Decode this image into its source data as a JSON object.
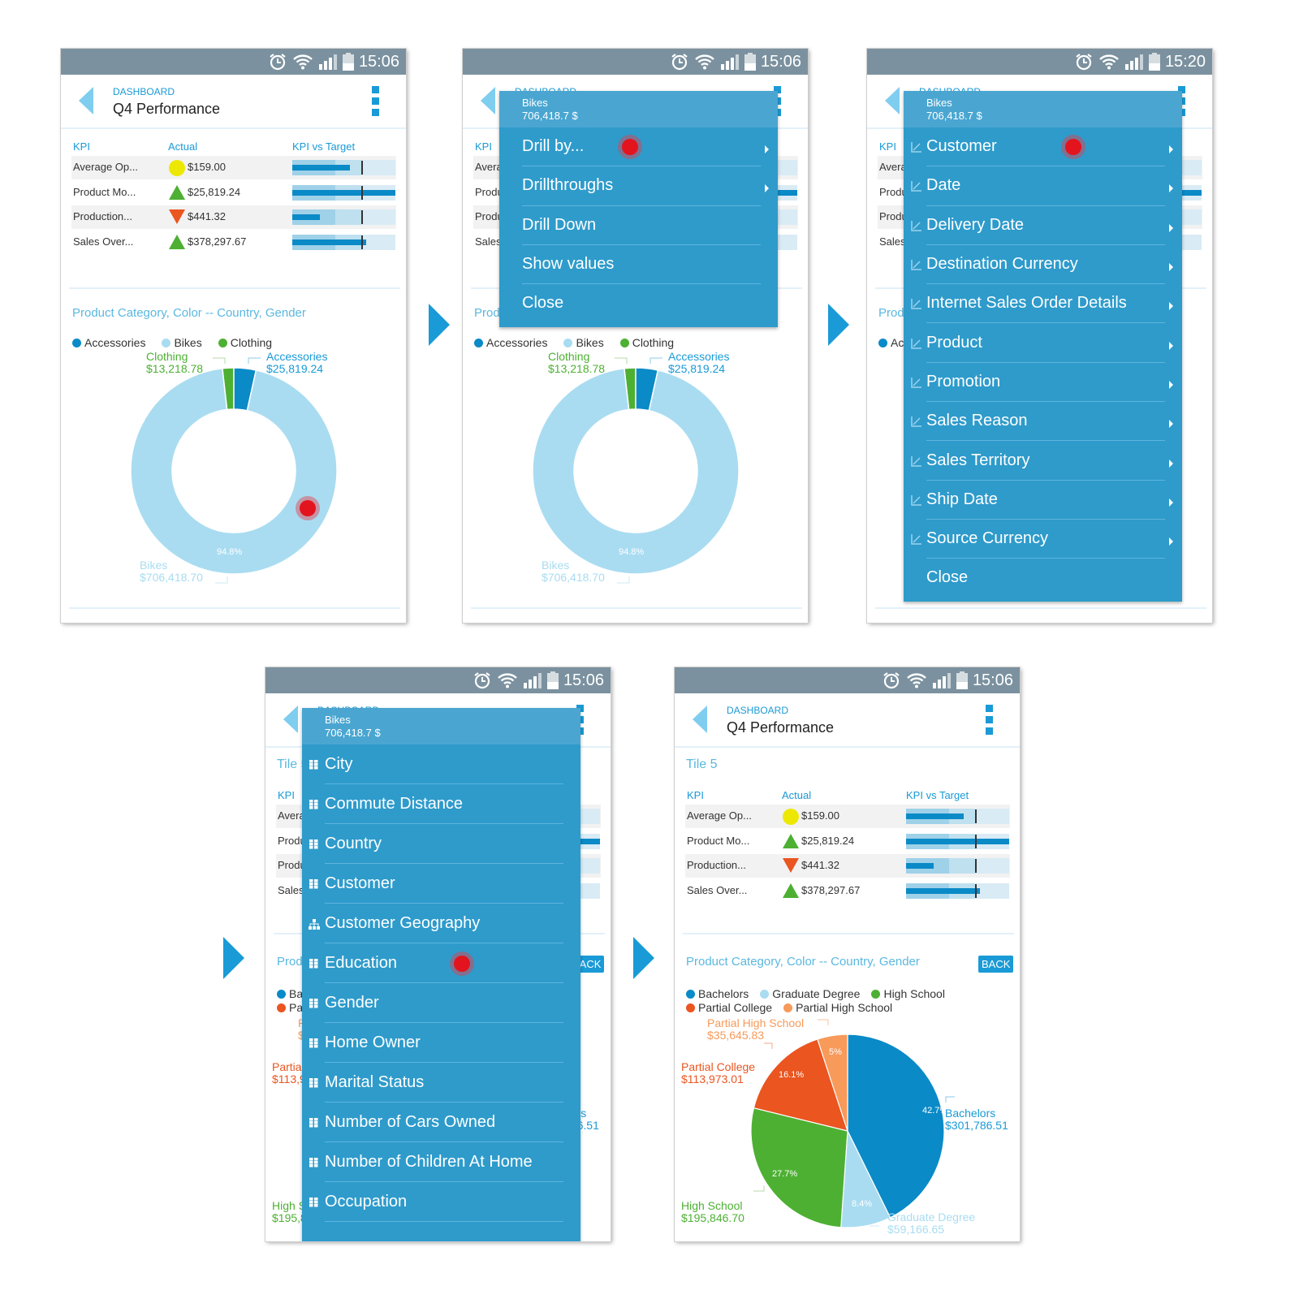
{
  "colors": {
    "status_bar": "#7b919f",
    "accent": "#1a9ad6",
    "menu": "#2e9bcb",
    "menu_header": "#4aa6d1",
    "accessories": "#0a8ac7",
    "bikes": "#a9dcf1",
    "clothing": "#4db033",
    "bachelors": "#0a8ac7",
    "graduate_degree": "#a9dcf1",
    "high_school": "#4db033",
    "partial_college": "#ea5520",
    "partial_high_school": "#f79a5a",
    "touch": "#e3141e"
  },
  "dashboard": {
    "breadcrumb": "DASHBOARD",
    "title": "Q4 Performance",
    "tile_label": "Tile 5",
    "kpi_headers": [
      "KPI",
      "Actual",
      "KPI vs Target"
    ],
    "kpis": [
      {
        "name": "Average Op...",
        "indicator": "yellow-circle",
        "value": "$159.00",
        "actual": 0.56,
        "target": 0.67
      },
      {
        "name": "Product Mo...",
        "indicator": "green-up-triangle",
        "value": "$25,819.24",
        "actual": 1.0,
        "target": 0.67
      },
      {
        "name": "Production...",
        "indicator": "red-down-triangle",
        "value": "$441.32",
        "actual": 0.27,
        "target": 0.67
      },
      {
        "name": "Sales Over...",
        "indicator": "green-up-triangle",
        "value": "$378,297.67",
        "actual": 0.72,
        "target": 0.67
      }
    ],
    "chart_title": "Product Category, Color -- Country, Gender",
    "back_label": "BACK"
  },
  "chart_data": [
    {
      "type": "pie",
      "variant": "donut",
      "title": "Product Category, Color -- Country, Gender",
      "legend": "top-left",
      "categories": [
        "Accessories",
        "Bikes",
        "Clothing"
      ],
      "values": [
        25819.24,
        706418.7,
        13218.78
      ],
      "labels": [
        "$25,819.24",
        "$706,418.70",
        "$13,218.78"
      ],
      "percent_labels": {
        "Bikes": "94.8%"
      }
    },
    {
      "type": "pie",
      "title": "Product Category, Color -- Country, Gender",
      "legend": "top-left",
      "categories": [
        "Bachelors",
        "Graduate Degree",
        "High School",
        "Partial College",
        "Partial High School"
      ],
      "values": [
        301786.51,
        59166.65,
        195846.7,
        113973.01,
        35645.83
      ],
      "labels": [
        "$301,786.51",
        "$59,166.65",
        "$195,846.70",
        "$113,973.01",
        "$35,645.83"
      ],
      "percents": [
        "42.7%",
        "8.4%",
        "27.7%",
        "16.1%",
        "5%"
      ]
    }
  ],
  "menus": {
    "header": {
      "name": "Bikes",
      "value": "706,418.7 $"
    },
    "context": {
      "items": [
        {
          "label": "Drill by...",
          "submenu": true
        },
        {
          "label": "Drillthroughs",
          "submenu": true
        },
        {
          "label": "Drill Down"
        },
        {
          "label": "Show values"
        },
        {
          "label": "Close"
        }
      ]
    },
    "drill_by": {
      "items": [
        {
          "label": "Customer",
          "submenu": true
        },
        {
          "label": "Date",
          "submenu": true
        },
        {
          "label": "Delivery Date",
          "submenu": true
        },
        {
          "label": "Destination Currency",
          "submenu": true
        },
        {
          "label": "Internet Sales Order Details",
          "submenu": true
        },
        {
          "label": "Product",
          "submenu": true
        },
        {
          "label": "Promotion",
          "submenu": true
        },
        {
          "label": "Sales Reason",
          "submenu": true
        },
        {
          "label": "Sales Territory",
          "submenu": true
        },
        {
          "label": "Ship Date",
          "submenu": true
        },
        {
          "label": "Source Currency",
          "submenu": true
        },
        {
          "label": "Close",
          "icon": "none"
        }
      ]
    },
    "customer": {
      "items": [
        {
          "label": "City",
          "icon": "grid"
        },
        {
          "label": "Commute Distance",
          "icon": "grid"
        },
        {
          "label": "Country",
          "icon": "grid"
        },
        {
          "label": "Customer",
          "icon": "grid"
        },
        {
          "label": "Customer Geography",
          "icon": "hierarchy"
        },
        {
          "label": "Education",
          "icon": "grid"
        },
        {
          "label": "Gender",
          "icon": "grid"
        },
        {
          "label": "Home Owner",
          "icon": "grid"
        },
        {
          "label": "Marital Status",
          "icon": "grid"
        },
        {
          "label": "Number of Cars Owned",
          "icon": "grid"
        },
        {
          "label": "Number of Children At Home",
          "icon": "grid"
        },
        {
          "label": "Occupation",
          "icon": "grid"
        }
      ]
    }
  },
  "screens": [
    {
      "time": "15:06",
      "view": "base",
      "menu": null,
      "touch_on": "Bikes slice"
    },
    {
      "time": "15:06",
      "view": "base",
      "menu": "context",
      "touch_on": "Drill by..."
    },
    {
      "time": "15:20",
      "view": "base",
      "menu": "drill_by",
      "touch_on": "Customer"
    },
    {
      "time": "15:06",
      "view": "tile5",
      "menu": "customer",
      "touch_on": "Education"
    },
    {
      "time": "15:06",
      "view": "tile5-pie",
      "menu": null,
      "touch_on": null
    }
  ]
}
